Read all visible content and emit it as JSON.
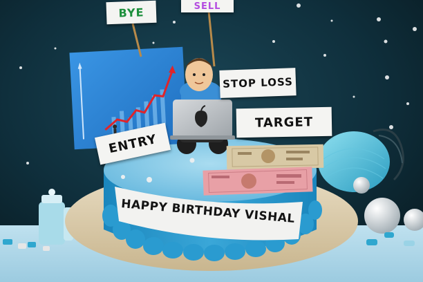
{
  "signs": {
    "bye": "BYE",
    "sell": "SELL",
    "stop_loss": "STOP LOSS",
    "target": "TARGET",
    "entry": "ENTRY"
  },
  "cake": {
    "message": "HAPPY BIRTHDAY VISHAL"
  },
  "colors": {
    "background": "#0c2a36",
    "cake_top": "#7fc6e3",
    "cake_side": "#1c8fc4",
    "board": "#d9c9a8",
    "chart_panel": "#2d86d8",
    "sign_bg": "#f4f4f2",
    "note_pink": "#e8a0a6",
    "note_beige": "#d8c9a5"
  }
}
